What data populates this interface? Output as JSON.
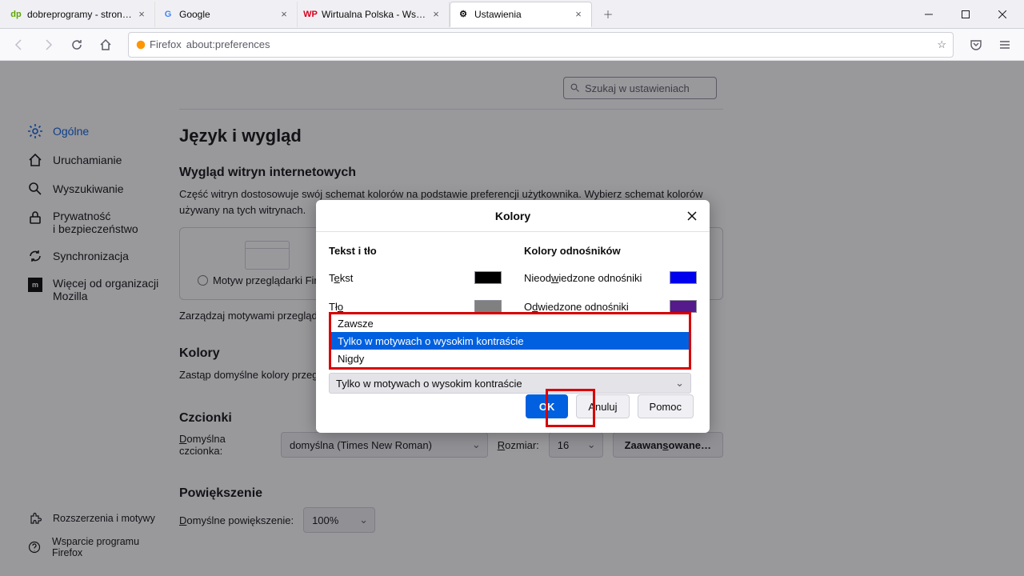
{
  "tabs": [
    {
      "title": "dobreprogramy - strona główna",
      "favicon_text": "dp",
      "favicon_color": "#5aa700"
    },
    {
      "title": "Google",
      "favicon_text": "G",
      "favicon_color": "#4285f4"
    },
    {
      "title": "Wirtualna Polska - Wszystko co",
      "favicon_text": "WP",
      "favicon_color": "#d6001c"
    },
    {
      "title": "Ustawienia",
      "favicon_text": "⚙",
      "favicon_color": "#5b5b66"
    }
  ],
  "url_bar": {
    "identity": "Firefox",
    "url": "about:preferences"
  },
  "sidebar": {
    "items": [
      {
        "label": "Ogólne"
      },
      {
        "label": "Uruchamianie"
      },
      {
        "label": "Wyszukiwanie"
      },
      {
        "label": "Prywatność\ni bezpieczeństwo"
      },
      {
        "label": "Synchronizacja"
      },
      {
        "label": "Więcej od organizacji\nMozilla"
      }
    ],
    "bottom": [
      {
        "label": "Rozszerzenia i motywy"
      },
      {
        "label": "Wsparcie programu Firefox"
      }
    ]
  },
  "search_placeholder": "Szukaj w ustawieniach",
  "main": {
    "title": "Język i wygląd",
    "appearance_title": "Wygląd witryn internetowych",
    "appearance_desc": "Część witryn dostosowuje swój schemat kolorów na podstawie preferencji użytkownika. Wybierz schemat kolorów używany na tych witrynach.",
    "theme_option": "Motyw przeglądarki Firefox",
    "manage_themes": "Zarządzaj motywami przeglądarki",
    "colors_title": "Kolory",
    "colors_desc": "Zastąp domyślne kolory przegl",
    "fonts_title": "Czcionki",
    "font_default_label": "Domyślna czcionka:",
    "font_default_value": "domyślna (Times New Roman)",
    "font_size_label": "Rozmiar:",
    "font_size_value": "16",
    "font_advanced": "Zaawansowane…",
    "zoom_title": "Powiększenie",
    "zoom_default_label": "Domyślne powiększenie:",
    "zoom_default_value": "100%"
  },
  "dialog": {
    "title": "Kolory",
    "text_bg_title": "Tekst i tło",
    "link_colors_title": "Kolory odnośników",
    "text_label": "Tekst",
    "bg_label": "Tło",
    "unvisited_label": "Nieodwiedzone odnośniki",
    "visited_label": "Odwiedzone odnośniki",
    "swatches": {
      "text": "#000000",
      "bg": "#808080",
      "unvisited": "#0000ee",
      "visited": "#551a8b"
    },
    "dropdown_options": [
      "Zawsze",
      "Tylko w motywach o wysokim kontraście",
      "Nigdy"
    ],
    "dropdown_selected": "Tylko w motywach o wysokim kontraście",
    "ok": "OK",
    "cancel": "Anuluj",
    "help": "Pomoc"
  }
}
